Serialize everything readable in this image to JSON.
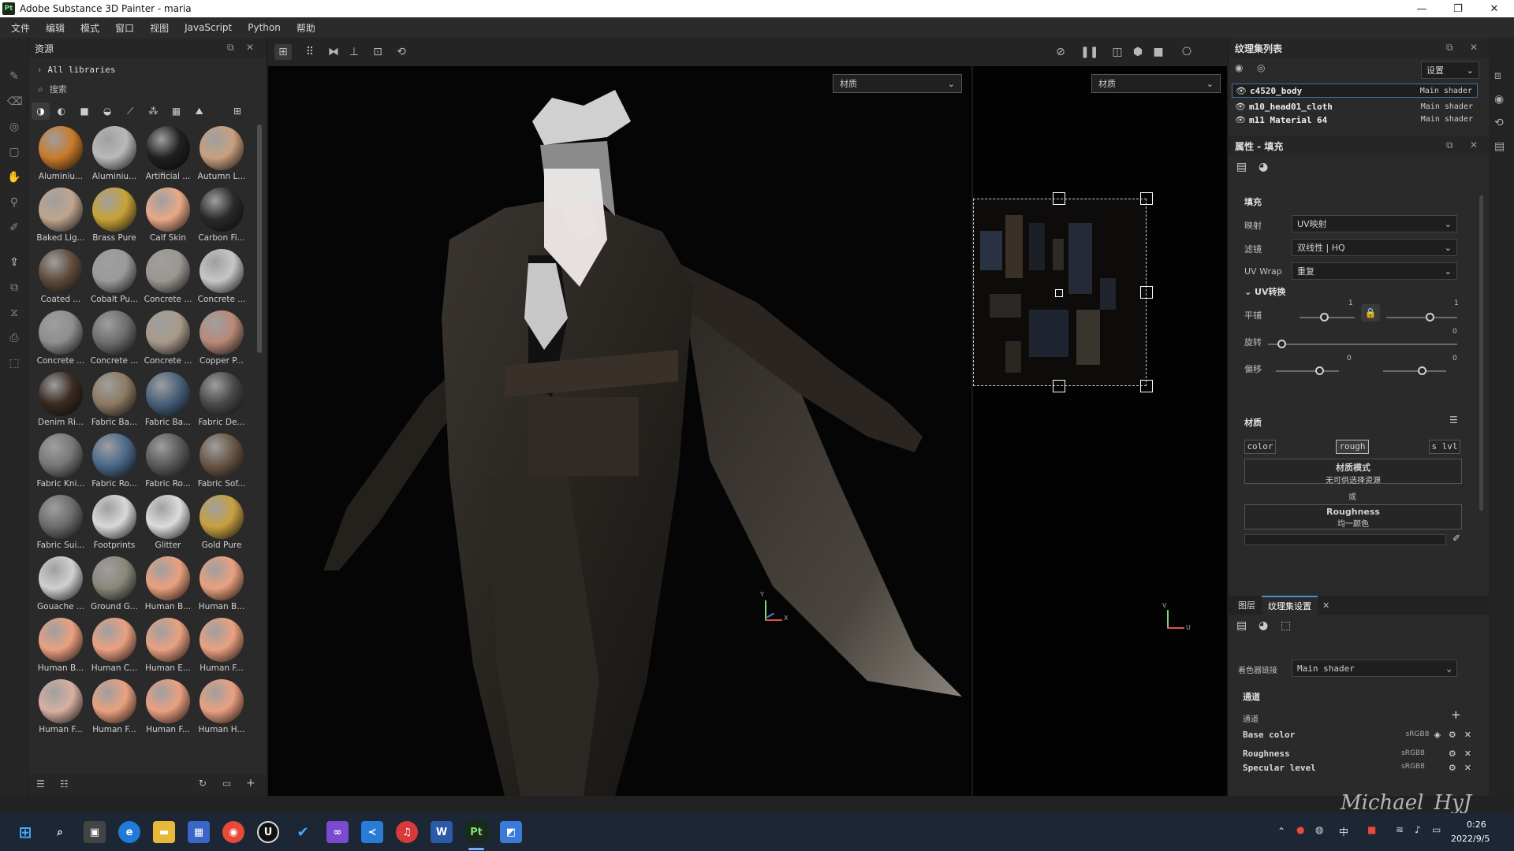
{
  "window": {
    "title": "Adobe Substance 3D Painter - maria",
    "app_badge": "Pt"
  },
  "menu": [
    "文件",
    "编辑",
    "模式",
    "窗口",
    "视图",
    "JavaScript",
    "Python",
    "帮助"
  ],
  "assets": {
    "title": "资源",
    "breadcrumb": "All libraries",
    "search_placeholder": "搜索",
    "materials": [
      {
        "name": "Aluminiu...",
        "color": "#c97a2a"
      },
      {
        "name": "Aluminiu...",
        "color": "#b9b9b9"
      },
      {
        "name": "Artificial ...",
        "color": "#202020"
      },
      {
        "name": "Autumn L...",
        "color": "#c8a080"
      },
      {
        "name": "Baked Lig...",
        "color": "#bfa58e"
      },
      {
        "name": "Brass Pure",
        "color": "#c8a238"
      },
      {
        "name": "Calf Skin",
        "color": "#e9a888"
      },
      {
        "name": "Carbon Fi...",
        "color": "#2a2a2a"
      },
      {
        "name": "Coated ...",
        "color": "#5d4a3a"
      },
      {
        "name": "Cobalt Pu...",
        "color": "#9a9a9a"
      },
      {
        "name": "Concrete ...",
        "color": "#9c9690"
      },
      {
        "name": "Concrete ...",
        "color": "#c6c6c6"
      },
      {
        "name": "Concrete ...",
        "color": "#8e8e8e"
      },
      {
        "name": "Concrete ...",
        "color": "#6e6e6e"
      },
      {
        "name": "Concrete ...",
        "color": "#a89a8a"
      },
      {
        "name": "Copper P...",
        "color": "#b88a78"
      },
      {
        "name": "Denim Ri...",
        "color": "#3a2a22"
      },
      {
        "name": "Fabric Ba...",
        "color": "#8c7a64"
      },
      {
        "name": "Fabric Ba...",
        "color": "#47607a"
      },
      {
        "name": "Fabric De...",
        "color": "#4a4a4a"
      },
      {
        "name": "Fabric Kni...",
        "color": "#777777"
      },
      {
        "name": "Fabric Ro...",
        "color": "#4c6a8a"
      },
      {
        "name": "Fabric Ro...",
        "color": "#5a5a5a"
      },
      {
        "name": "Fabric Sof...",
        "color": "#6a5646"
      },
      {
        "name": "Fabric Sui...",
        "color": "#6c6c6c"
      },
      {
        "name": "Footprints",
        "color": "#d8d8d8"
      },
      {
        "name": "Glitter",
        "color": "#dcdcdc"
      },
      {
        "name": "Gold Pure",
        "color": "#c8a040"
      },
      {
        "name": "Gouache ...",
        "color": "#d0d0d0"
      },
      {
        "name": "Ground G...",
        "color": "#8a8678"
      },
      {
        "name": "Human B...",
        "color": "#eaa080"
      },
      {
        "name": "Human B...",
        "color": "#eaa080"
      },
      {
        "name": "Human B...",
        "color": "#eaa080"
      },
      {
        "name": "Human C...",
        "color": "#eaa080"
      },
      {
        "name": "Human E...",
        "color": "#eaa080"
      },
      {
        "name": "Human F...",
        "color": "#eaa080"
      },
      {
        "name": "Human F...",
        "color": "#d8b0a0"
      },
      {
        "name": "Human F...",
        "color": "#eaa080"
      },
      {
        "name": "Human F...",
        "color": "#eaa080"
      },
      {
        "name": "Human H...",
        "color": "#eaa080"
      }
    ]
  },
  "viewport": {
    "material_mode_left": "材质",
    "material_mode_right": "材质",
    "axis_labels": {
      "y": "Y",
      "x": "X",
      "v": "V",
      "u": "U"
    }
  },
  "texture_sets": {
    "title": "纹理集列表",
    "settings_label": "设置",
    "items": [
      {
        "name": "c4520_body",
        "shader": "Main shader"
      },
      {
        "name": "m10_head01_cloth",
        "shader": "Main shader"
      },
      {
        "name": "m11_Material_64",
        "shader": "Main shader"
      }
    ]
  },
  "properties": {
    "title": "属性 - 填充",
    "fill_heading": "填充",
    "mapping_label": "映射",
    "mapping_value": "UV映射",
    "filter_label": "滤镜",
    "filter_value": "双线性 | HQ",
    "uvwrap_label": "UV Wrap",
    "uvwrap_value": "重复",
    "uv_transform": "UV转换",
    "scale_label": "平铺",
    "scale_value": "1",
    "scale_value2": "1",
    "rotation_label": "旋转",
    "rotation_value": "0",
    "offset_label": "偏移",
    "offset_x": "0",
    "offset_y": "0",
    "material_heading": "材质",
    "chan_color": "color",
    "chan_rough": "rough",
    "chan_lvl": "s lvl",
    "material_mode_title": "材质模式",
    "material_mode_sub": "无可供选择资源",
    "or_label": "或",
    "roughness_title": "Roughness",
    "roughness_sub": "均一颜色"
  },
  "bottom_tabs": {
    "layers": "图层",
    "texset_settings": "纹理集设置"
  },
  "texset_settings": {
    "shader_link_label": "着色器链接",
    "shader_link_value": "Main shader",
    "channels_heading": "通道",
    "channels_label": "通道",
    "channels": [
      {
        "name": "Base color",
        "format": "sRGB8"
      },
      {
        "name": "Roughness",
        "format": "sRGB8"
      },
      {
        "name": "Specular level",
        "format": "sRGB8"
      }
    ]
  },
  "watermark": "Michael_HyJ",
  "taskbar": {
    "time": "0:26",
    "date": "2022/9/5",
    "ime": "中"
  }
}
